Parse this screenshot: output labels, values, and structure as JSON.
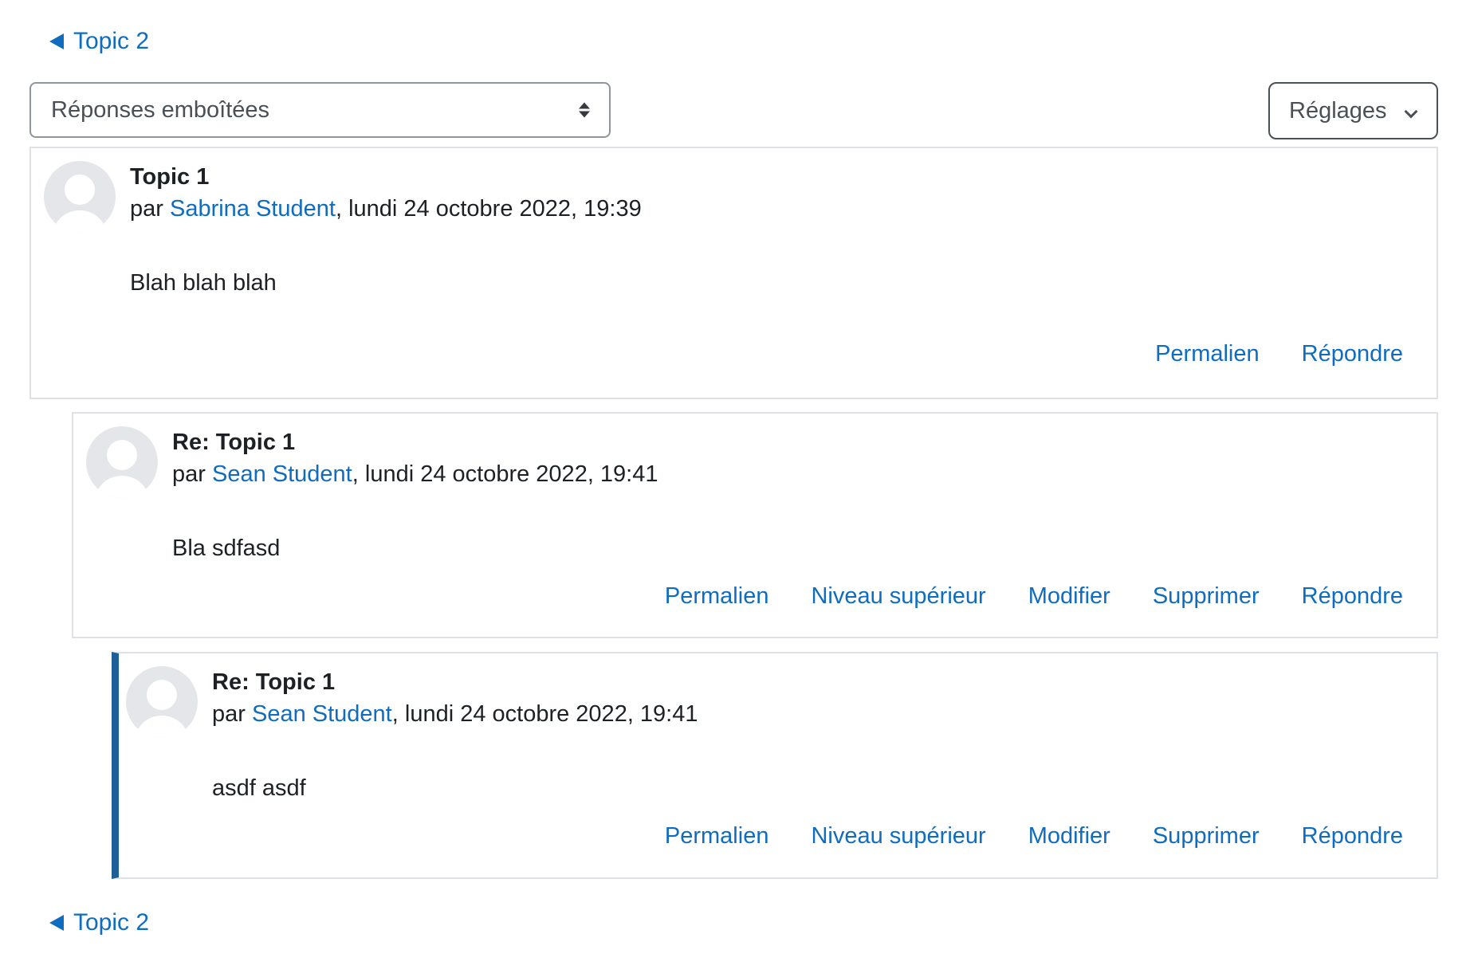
{
  "navigation": {
    "prev_top_label": "Topic 2",
    "prev_bottom_label": "Topic 2"
  },
  "display_mode": {
    "selected": "Réponses emboîtées"
  },
  "settings": {
    "label": "Réglages"
  },
  "byline_prefix": "par ",
  "byline_separator": ", ",
  "posts": [
    {
      "subject": "Topic 1",
      "author": "Sabrina Student",
      "date": "lundi 24 octobre 2022, 19:39",
      "message": "Blah blah blah",
      "actions": {
        "permalink": "Permalien",
        "reply": "Répondre"
      }
    },
    {
      "subject": "Re: Topic 1",
      "author": "Sean Student",
      "date": "lundi 24 octobre 2022, 19:41",
      "message": "Bla sdfasd",
      "actions": {
        "permalink": "Permalien",
        "parent": "Niveau supérieur",
        "edit": "Modifier",
        "delete": "Supprimer",
        "reply": "Répondre"
      }
    },
    {
      "subject": "Re: Topic 1",
      "author": "Sean Student",
      "date": "lundi 24 octobre 2022, 19:41",
      "message": "asdf asdf",
      "actions": {
        "permalink": "Permalien",
        "parent": "Niveau supérieur",
        "edit": "Modifier",
        "delete": "Supprimer",
        "reply": "Répondre"
      }
    }
  ],
  "colors": {
    "link": "#0f6cbf",
    "text": "#1d2125",
    "border": "#dee2e6",
    "highlight_border": "#1f5f97",
    "avatar_bg": "#e4e6e9"
  }
}
